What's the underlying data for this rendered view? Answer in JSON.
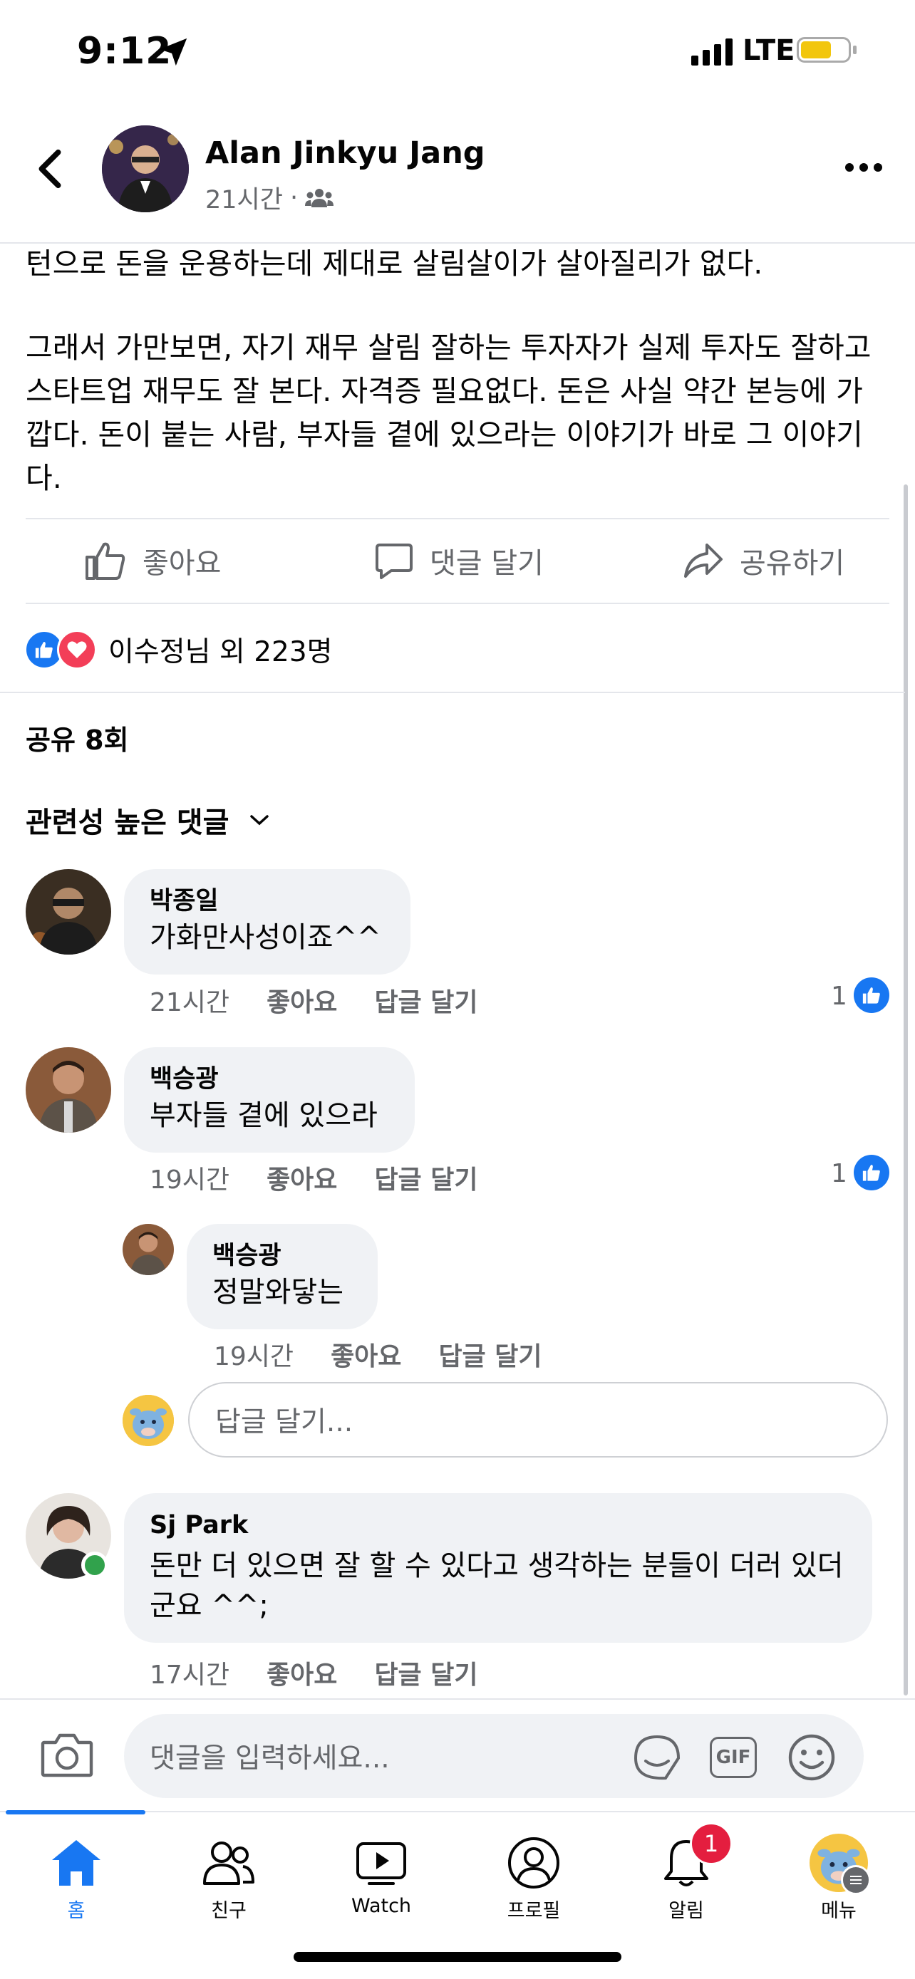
{
  "status_bar": {
    "time": "9:12",
    "network": "LTE"
  },
  "header": {
    "author": "Alan Jinkyu Jang",
    "time": "21시간",
    "separator": "·"
  },
  "post": {
    "text_line1": "턴으로 돈을 운용하는데 제대로 살림살이가 살아질리가 없다.",
    "text_para2": "그래서 가만보면, 자기 재무 살림 잘하는 투자자가  실제 투자도 잘하고 스타트업 재무도 잘 본다. 자격증 필요없다. 돈은 사실 약간 본능에 가깝다. 돈이 붙는 사람, 부자들 곁에 있으라는 이야기가 바로 그 이야기다."
  },
  "actions": {
    "like": "좋아요",
    "comment": "댓글 달기",
    "share": "공유하기"
  },
  "reactions": {
    "summary": "이수정님 외 223명"
  },
  "shares": "공유 8회",
  "sort": {
    "label": "관련성 높은 댓글"
  },
  "comments": [
    {
      "name": "박종일",
      "text": "가화만사성이죠^^",
      "time": "21시간",
      "like": "좋아요",
      "reply": "답글 달기",
      "like_count": "1"
    },
    {
      "name": "백승광",
      "text": "부자들 곁에 있으라",
      "time": "19시간",
      "like": "좋아요",
      "reply": "답글 달기",
      "like_count": "1"
    },
    {
      "name": "백승광",
      "text": "정말와닿는",
      "time": "19시간",
      "like": "좋아요",
      "reply": "답글 달기"
    },
    {
      "name": "Sj Park",
      "text": "돈만 더 있으면 잘 할 수 있다고 생각하는 분들이 더러 있더군요 ^^;",
      "time": "17시간",
      "like": "좋아요",
      "reply": "답글 달기"
    }
  ],
  "reply_input": {
    "placeholder": "답글 달기..."
  },
  "comment_input": {
    "placeholder": "댓글을 입력하세요...",
    "gif": "GIF"
  },
  "tabs": {
    "home": "홈",
    "friends": "친구",
    "watch": "Watch",
    "profile": "프로필",
    "notifications": "알림",
    "menu": "메뉴",
    "notif_badge": "1"
  },
  "colors": {
    "accent": "#1877f2",
    "badge": "#e41e3f",
    "text": "#050505",
    "secondary": "#65676b",
    "bubble": "#f0f2f5"
  }
}
